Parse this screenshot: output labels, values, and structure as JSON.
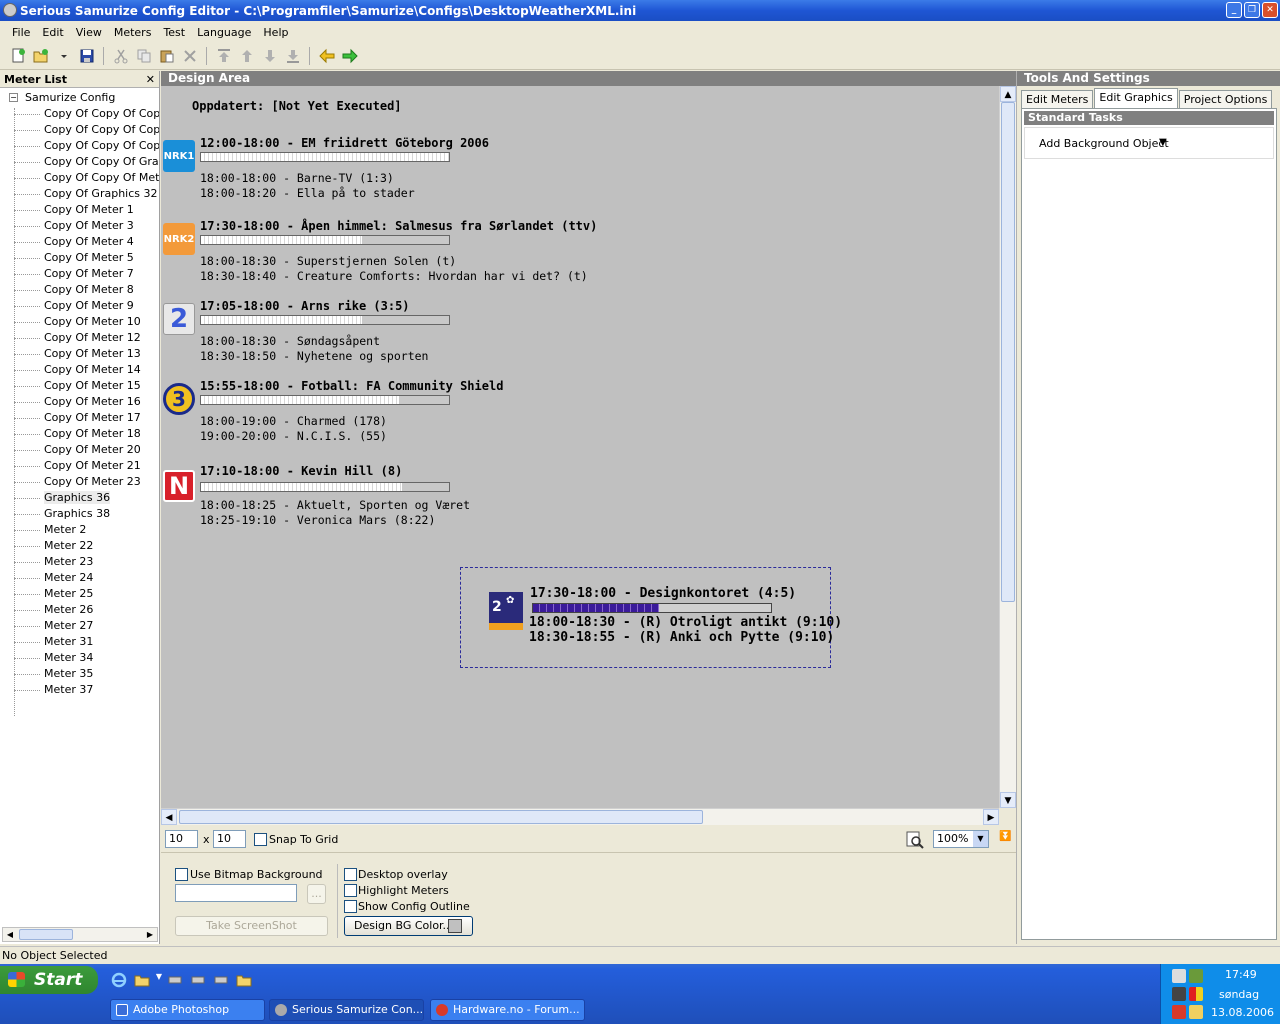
{
  "window": {
    "title": "Serious Samurize Config Editor - C:\\Programfiler\\Samurize\\Configs\\DesktopWeatherXML.ini",
    "minimize": "_",
    "restore": "❐",
    "close": "✕"
  },
  "menu": [
    "File",
    "Edit",
    "View",
    "Meters",
    "Test",
    "Language",
    "Help"
  ],
  "meter_list": {
    "header": "Meter List",
    "close_glyph": "✕",
    "root": "Samurize Config",
    "expander": "−",
    "items": [
      "Copy Of Copy Of Copy",
      "Copy Of Copy Of Copy",
      "Copy Of Copy Of Copy",
      "Copy Of Copy Of Graph",
      "Copy Of Copy Of Meter",
      "Copy Of Graphics 32",
      "Copy Of Meter 1",
      "Copy Of Meter 3",
      "Copy Of Meter 4",
      "Copy Of Meter 5",
      "Copy Of Meter 7",
      "Copy Of Meter 8",
      "Copy Of Meter 9",
      "Copy Of Meter 10",
      "Copy Of Meter 12",
      "Copy Of Meter 13",
      "Copy Of Meter 14",
      "Copy Of Meter 15",
      "Copy Of Meter 16",
      "Copy Of Meter 17",
      "Copy Of Meter 18",
      "Copy Of Meter 20",
      "Copy Of Meter 21",
      "Copy Of Meter 23",
      "Graphics 36",
      "Graphics 38",
      "Meter 2",
      "Meter 22",
      "Meter 23",
      "Meter 24",
      "Meter 25",
      "Meter 26",
      "Meter 27",
      "Meter 31",
      "Meter 34",
      "Meter 35",
      "Meter 37"
    ],
    "selected_index": 24
  },
  "design": {
    "header": "Design Area",
    "updated": "Oppdatert:  [Not Yet Executed]",
    "channels": [
      {
        "logo": "NRK1",
        "logo_color": "#1a8fd8",
        "title": "12:00-18:00 - EM friidrett Göteborg 2006",
        "progress": 1.0,
        "next1": "18:00-18:00 - Barne-TV (1:3)",
        "next2": "18:00-18:20 - Ella på to stader"
      },
      {
        "logo": "NRK2",
        "logo_color": "#f39a3a",
        "title": "17:30-18:00 - Åpen himmel: Salmesus fra Sørlandet (ttv)",
        "progress": 0.65,
        "next1": "18:00-18:30 - Superstjernen Solen (t)",
        "next2": "18:30-18:40 - Creature Comforts: Hvordan har vi det? (t)"
      },
      {
        "logo": "2",
        "logo_color": "#e8e8e8",
        "title": "17:05-18:00 - Arns rike (3:5)",
        "progress": 0.65,
        "next1": "18:00-18:30 - Søndagsåpent",
        "next2": "18:30-18:50 - Nyhetene og sporten"
      },
      {
        "logo": "3",
        "logo_color": "#f0c020",
        "title": "15:55-18:00 - Fotball: FA Community Shield",
        "progress": 0.8,
        "next1": "18:00-19:00 - Charmed (178)",
        "next2": "19:00-20:00 - N.C.I.S. (55)"
      },
      {
        "logo": "N",
        "logo_color": "#d8202a",
        "title": "17:10-18:00 - Kevin Hill (8)",
        "progress": 0.81,
        "next1": "18:00-18:25 - Aktuelt, Sporten og Været",
        "next2": "18:25-19:10 - Veronica Mars (8:22)"
      }
    ],
    "selected_meter": {
      "logo": "2",
      "title": "17:30-18:00 - Designkontoret (4:5)",
      "progress": 0.53,
      "next1": "18:00-18:30 - (R) Otroligt antikt (9:10)",
      "next2": "18:30-18:55 - (R) Anki och Pytte (9:10)"
    }
  },
  "grid": {
    "width": "10",
    "x": "x",
    "height": "10",
    "snap_label": "Snap To Grid",
    "zoom": "100%"
  },
  "bottom": {
    "use_bitmap": "Use Bitmap Background",
    "browse": "...",
    "take_screenshot": "Take ScreenShot",
    "desktop_overlay": "Desktop overlay",
    "highlight_meters": "Highlight Meters",
    "show_outline": "Show Config Outline",
    "design_bg": "Design BG Color..."
  },
  "tools": {
    "header": "Tools And Settings",
    "tabs": [
      "Edit Meters",
      "Edit Graphics",
      "Project Options"
    ],
    "active_tab": 1,
    "section": "Standard Tasks",
    "add_bg": "Add Background Object",
    "dropdown_glyph": "▼"
  },
  "status": "No Object Selected",
  "taskbar": {
    "start": "Start",
    "tasks": [
      "Adobe Photoshop",
      "Serious Samurize Con...",
      "Hardware.no - Forum..."
    ],
    "time": "17:49",
    "day": "søndag",
    "date": "13.08.2006"
  },
  "colors": {
    "design_bg": "#c0c0c0",
    "selection_dash": "#2b2b9a",
    "progress_purple": "#3a1a9a"
  }
}
